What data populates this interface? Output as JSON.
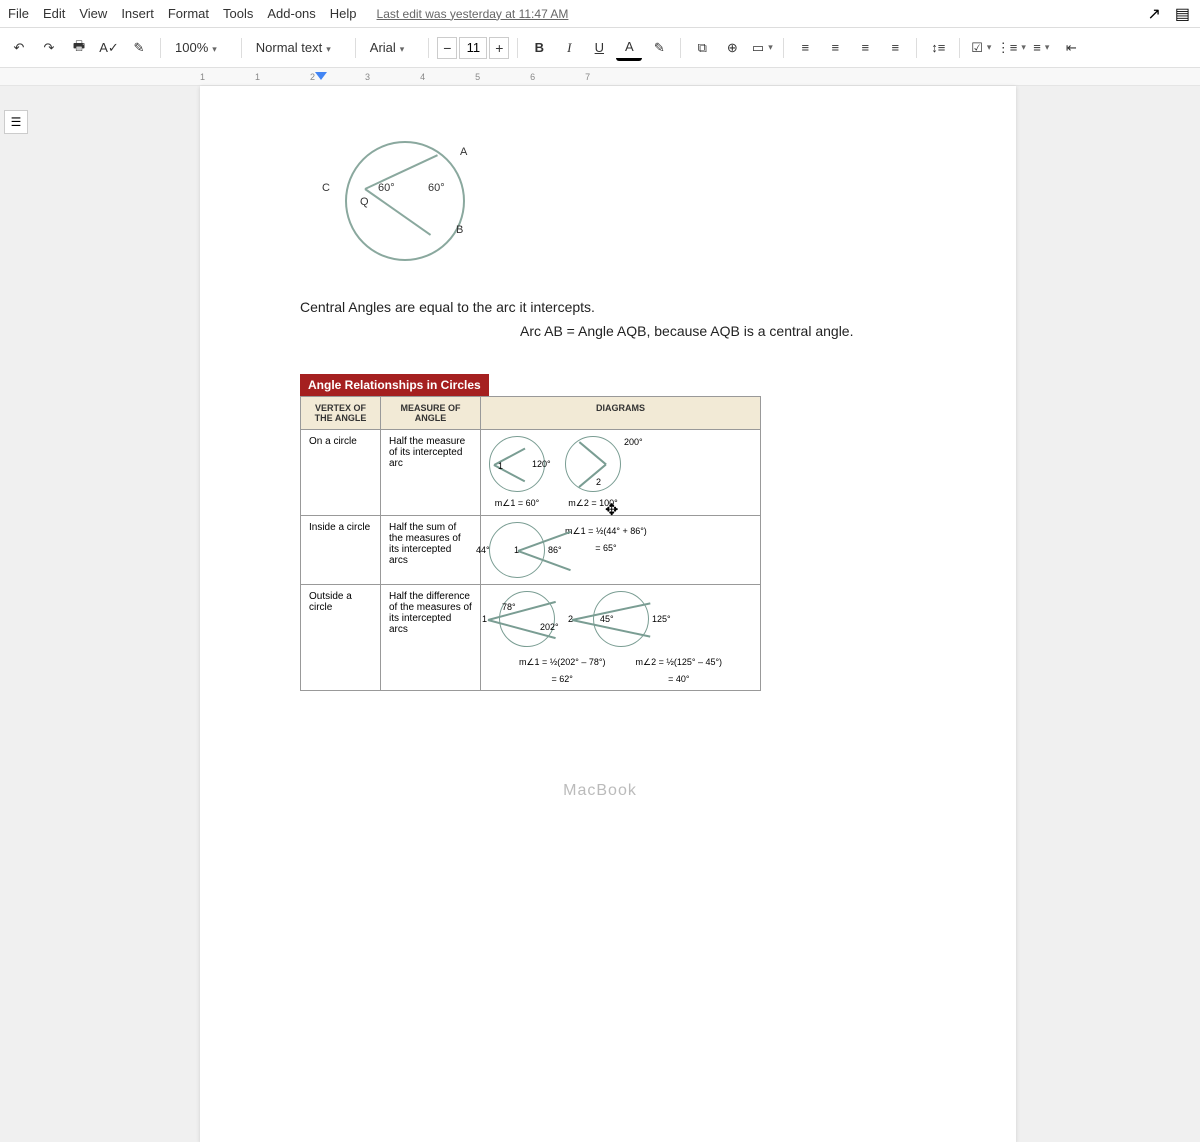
{
  "menu": {
    "file": "File",
    "edit": "Edit",
    "view": "View",
    "insert": "Insert",
    "format": "Format",
    "tools": "Tools",
    "addons": "Add-ons",
    "help": "Help",
    "last_edit": "Last edit was yesterday at 11:47 AM"
  },
  "toolbar": {
    "zoom": "100%",
    "style": "Normal text",
    "font": "Arial",
    "fontsize": "11",
    "bold": "B",
    "italic": "I",
    "underline": "U",
    "textcolor": "A"
  },
  "ruler": {
    "marks": [
      "1",
      "1",
      "2",
      "3",
      "4",
      "5",
      "6",
      "7"
    ]
  },
  "doc": {
    "circ_label_a": "A",
    "circ_label_b": "B",
    "circ_label_c": "C",
    "circ_label_q": "Q",
    "circ_angle1": "60°",
    "circ_angle2": "60°",
    "line1": "Central Angles are equal to the arc it intercepts.",
    "line2": "Arc AB =  Angle AQB, because AQB is a central angle.",
    "table_title": "Angle Relationships in Circles",
    "th_vertex": "VERTEX OF THE ANGLE",
    "th_measure": "MEASURE OF ANGLE",
    "th_diagrams": "DIAGRAMS",
    "row1": {
      "vertex": "On a circle",
      "measure": "Half the measure of its intercepted arc",
      "d1_arc": "120°",
      "d1_angle": "1",
      "d1_eq": "m∠1 = 60°",
      "d2_arc": "200°",
      "d2_angle": "2",
      "d2_eq": "m∠2 = 100°"
    },
    "row2": {
      "vertex": "Inside a circle",
      "measure": "Half the sum of the measures of its intercepted arcs",
      "arc1": "44°",
      "arc2": "86°",
      "angle": "1",
      "eq1": "m∠1 = ½(44° + 86°)",
      "eq2": "= 65°"
    },
    "row3": {
      "vertex": "Outside a circle",
      "measure": "Half the difference of the measures of its intercepted arcs",
      "d1_arc1": "78°",
      "d1_arc2": "202°",
      "d1_angle": "1",
      "d2_arc1": "45°",
      "d2_arc2": "125°",
      "d2_angle": "2",
      "eq1": "m∠1 = ½(202° – 78°)",
      "eq1b": "= 62°",
      "eq2": "m∠2 = ½(125° – 45°)",
      "eq2b": "= 40°"
    }
  },
  "device": "MacBook"
}
